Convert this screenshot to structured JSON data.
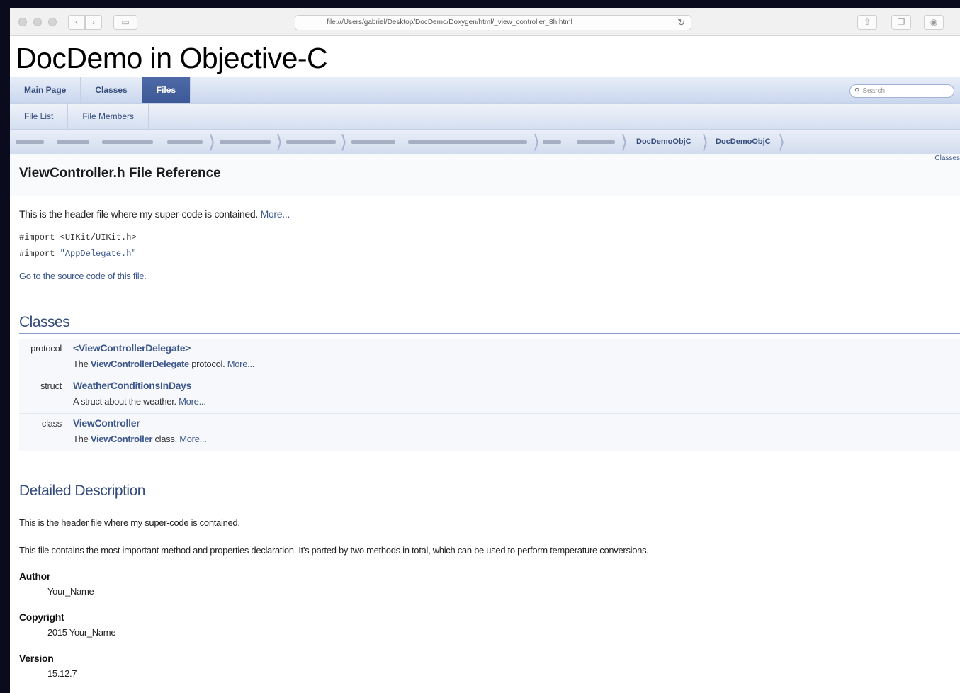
{
  "browser": {
    "url": "file:///Users/gabriel/Desktop/DocDemo/Doxygen/html/_view_controller_8h.html"
  },
  "project": {
    "title": "DocDemo in Objective-C"
  },
  "main_nav": {
    "tabs": [
      {
        "label": "Main Page"
      },
      {
        "label": "Classes"
      },
      {
        "label": "Files"
      }
    ],
    "search_placeholder": "Search"
  },
  "sub_nav": {
    "tabs": [
      {
        "label": "File List"
      },
      {
        "label": "File Members"
      }
    ]
  },
  "breadcrumb": {
    "items": [
      "DocDemoObjC",
      "DocDemoObjC"
    ]
  },
  "page": {
    "title": "ViewController.h File Reference",
    "summary_link": "Classes",
    "brief": "This is the header file where my super-code is contained.",
    "more_link": "More...",
    "includes": [
      {
        "keyword": "#import",
        "file": "<UIKit/UIKit.h>"
      },
      {
        "keyword": "#import",
        "file": "\"AppDelegate.h\""
      }
    ],
    "goto_source": "Go to the source code of this file."
  },
  "classes": {
    "title": "Classes",
    "rows": [
      {
        "kind": "protocol",
        "name": "<ViewControllerDelegate>",
        "desc_prefix": "The",
        "desc_ref": "ViewControllerDelegate",
        "desc_suffix": "protocol.",
        "more": "More..."
      },
      {
        "kind": "struct",
        "name": "WeatherConditionsInDays",
        "desc_prefix": "A struct about the weather.",
        "desc_ref": "",
        "desc_suffix": "",
        "more": "More..."
      },
      {
        "kind": "class",
        "name": "ViewController",
        "desc_prefix": "The",
        "desc_ref": "ViewController",
        "desc_suffix": "class.",
        "more": "More..."
      }
    ]
  },
  "detailed": {
    "title": "Detailed Description",
    "para1": "This is the header file where my super-code is contained.",
    "para2": "This file contains the most important method and properties declaration. It's parted by two methods in total, which can be used to perform temperature conversions.",
    "author_label": "Author",
    "author_value": "Your_Name",
    "copyright_label": "Copyright",
    "copyright_value": "2015 Your_Name",
    "version_label": "Version",
    "version_value": "15.12.7"
  }
}
